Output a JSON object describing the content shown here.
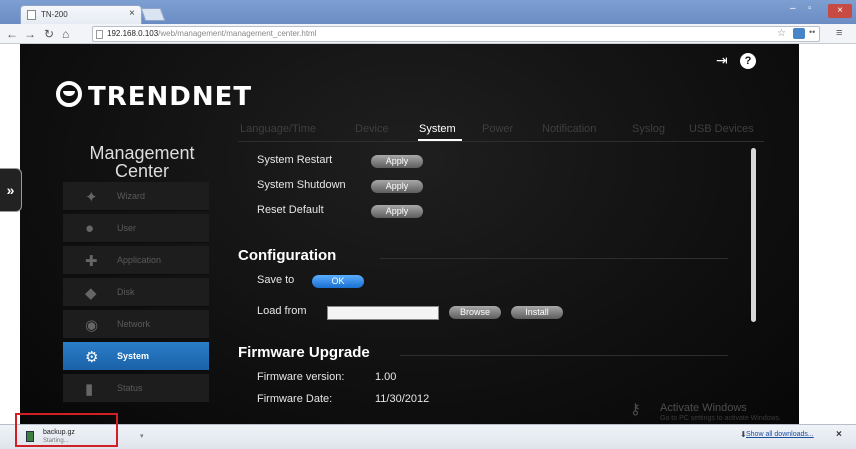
{
  "browser": {
    "tab_title": "TN-200",
    "tab_close": "×",
    "url_host": "192.168.0.103",
    "url_path": "/web/management/management_center.html",
    "window_min": "–",
    "window_max": "▫",
    "window_close": "×"
  },
  "app": {
    "brand": "TRENDNET",
    "nav_title_line1": "Management",
    "nav_title_line2": "Center",
    "expander": "»"
  },
  "sidebar": {
    "items": [
      {
        "label": "Wizard",
        "icon": "wand-icon",
        "glyph": "✦"
      },
      {
        "label": "User",
        "icon": "user-icon",
        "glyph": "●"
      },
      {
        "label": "Application",
        "icon": "puzzle-icon",
        "glyph": "✚"
      },
      {
        "label": "Disk",
        "icon": "disk-icon",
        "glyph": "◆"
      },
      {
        "label": "Network",
        "icon": "network-icon",
        "glyph": "◉"
      },
      {
        "label": "System",
        "icon": "gears-icon",
        "glyph": "⚙"
      },
      {
        "label": "Status",
        "icon": "status-bars-icon",
        "glyph": "▮"
      }
    ],
    "active": "System"
  },
  "tabs": [
    "Language/Time",
    "Device",
    "System",
    "Power",
    "Notification",
    "Syslog",
    "USB Devices"
  ],
  "active_tab": "System",
  "system_actions": [
    {
      "label": "System Restart",
      "button": "Apply"
    },
    {
      "label": "System Shutdown",
      "button": "Apply"
    },
    {
      "label": "Reset Default",
      "button": "Apply"
    }
  ],
  "configuration": {
    "title": "Configuration",
    "save_label": "Save to",
    "save_button": "OK",
    "load_label": "Load from",
    "load_value": "",
    "browse_button": "Browse",
    "install_button": "Install"
  },
  "firmware": {
    "title": "Firmware Upgrade",
    "version_label": "Firmware version:",
    "version_value": "1.00",
    "date_label": "Firmware Date:",
    "date_value": "11/30/2012"
  },
  "watermark": {
    "line1": "Activate Windows",
    "line2": "Go to PC settings to activate Windows."
  },
  "downloads": {
    "file_name": "backup.gz",
    "status": "Starting...",
    "show_all": "Show all downloads...",
    "close": "×"
  }
}
